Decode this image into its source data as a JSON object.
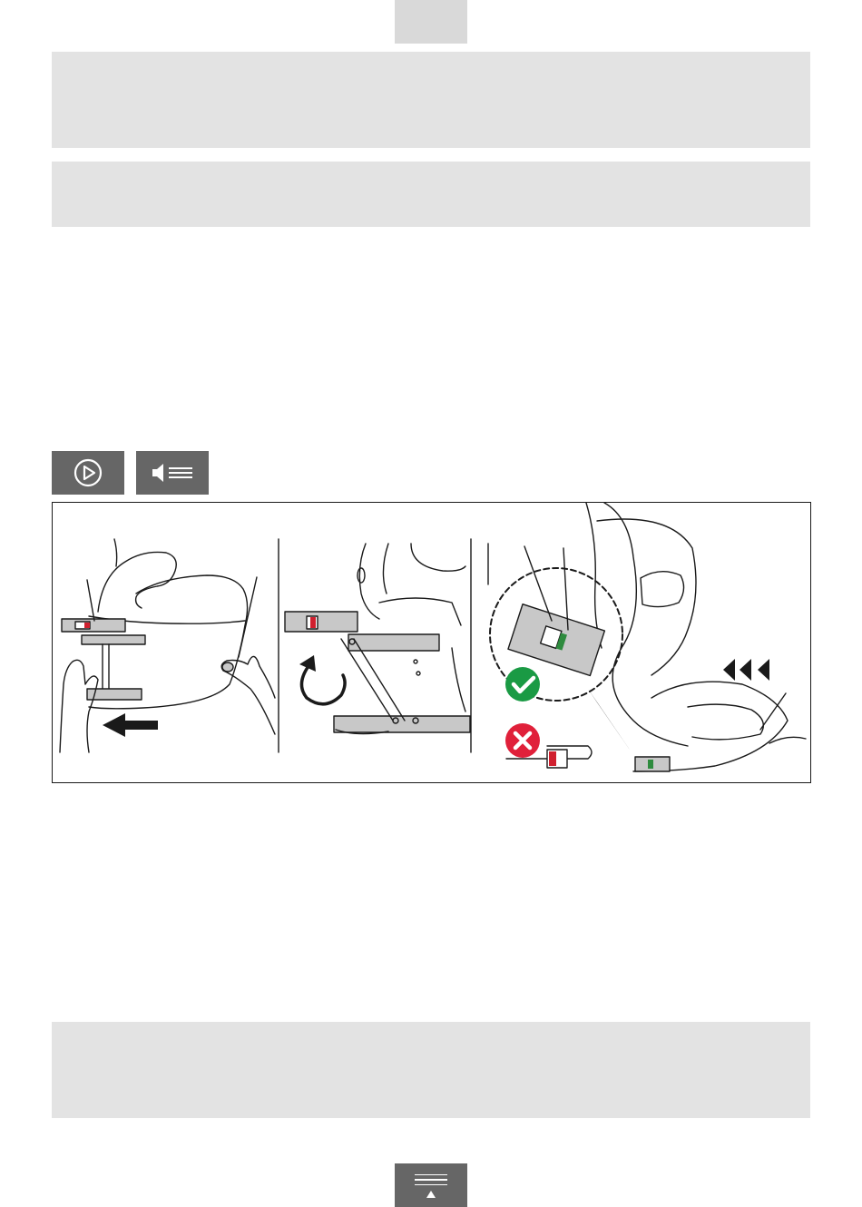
{
  "header": {
    "page_tab": {
      "icon": "blank-tab"
    }
  },
  "notes": [
    {
      "id": "note-top-1",
      "text": ""
    },
    {
      "id": "note-top-2",
      "text": ""
    },
    {
      "id": "note-bottom",
      "text": ""
    }
  ],
  "media": {
    "play": {
      "icon": "play-circle-icon"
    },
    "audio": {
      "icon": "speaker-list-icon"
    }
  },
  "figure": {
    "panels": [
      {
        "name": "pull-isofix-connector",
        "arrow": "left"
      },
      {
        "name": "rotate-isofix-arm",
        "arrow": "rotate-counterclockwise"
      },
      {
        "name": "check-indicator",
        "indicator_ok_color": "#2e8b3e",
        "indicator_bad_color": "#d0202f",
        "push_arrows": "left"
      }
    ],
    "colors": {
      "ok": "#1a9a44",
      "bad": "#e0203a",
      "metal": "#c8c8c8",
      "line": "#1a1a1a"
    }
  },
  "footer": {
    "toc": {
      "icon": "toc-up-icon"
    }
  }
}
